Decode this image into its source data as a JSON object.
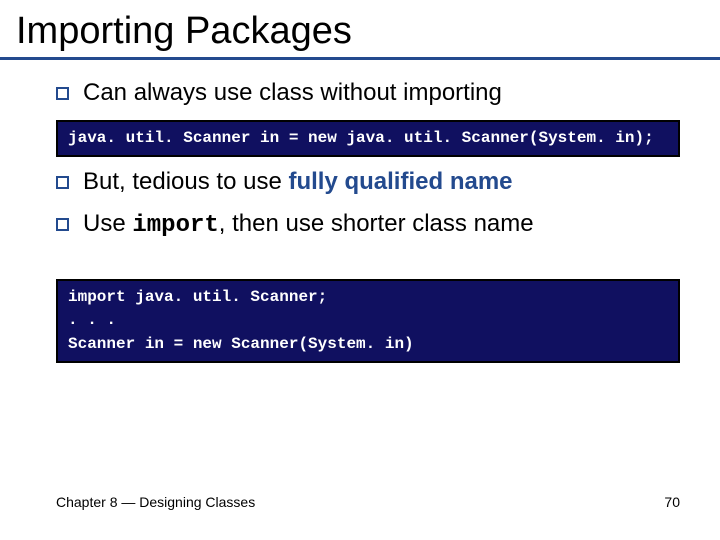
{
  "title": "Importing Packages",
  "bullets": {
    "b1": "Can always use class without importing",
    "b2_pre": "But, tedious to use ",
    "b2_emph": "fully qualified name",
    "b3_pre": "Use ",
    "b3_code": "import",
    "b3_post": ", then use shorter class name"
  },
  "code": {
    "box1": "java. util. Scanner in = new java. util. Scanner(System. in);",
    "box2": "import java. util. Scanner;\n. . .\nScanner in = new Scanner(System. in)"
  },
  "footer": {
    "left": "Chapter 8 — Designing Classes",
    "right": "70"
  }
}
